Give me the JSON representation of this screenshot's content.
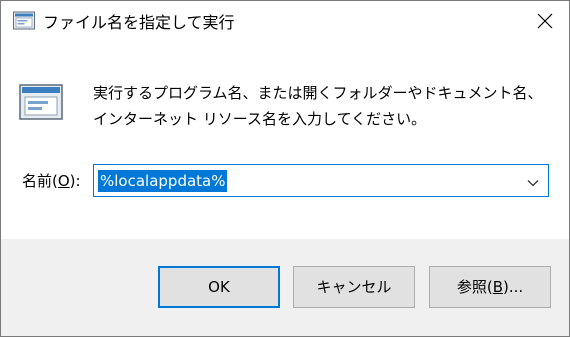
{
  "window": {
    "title": "ファイル名を指定して実行",
    "close_glyph": "✕"
  },
  "main": {
    "description": "実行するプログラム名、または開くフォルダーやドキュメント名、インターネット リソース名を入力してください。",
    "open_label_prefix": "名前(",
    "open_label_accel": "O",
    "open_label_suffix": "):",
    "open_value": "%localappdata%"
  },
  "buttons": {
    "ok_label": "OK",
    "cancel_label": "キャンセル",
    "browse_prefix": "参照(",
    "browse_accel": "B",
    "browse_suffix": ")..."
  },
  "colors": {
    "accent": "#0078d7",
    "footer_bg": "#f0f0f0",
    "button_bg": "#e1e1e1"
  },
  "icons": {
    "app": "run-window-icon",
    "close": "close-icon",
    "dropdown": "chevron-down-icon"
  }
}
